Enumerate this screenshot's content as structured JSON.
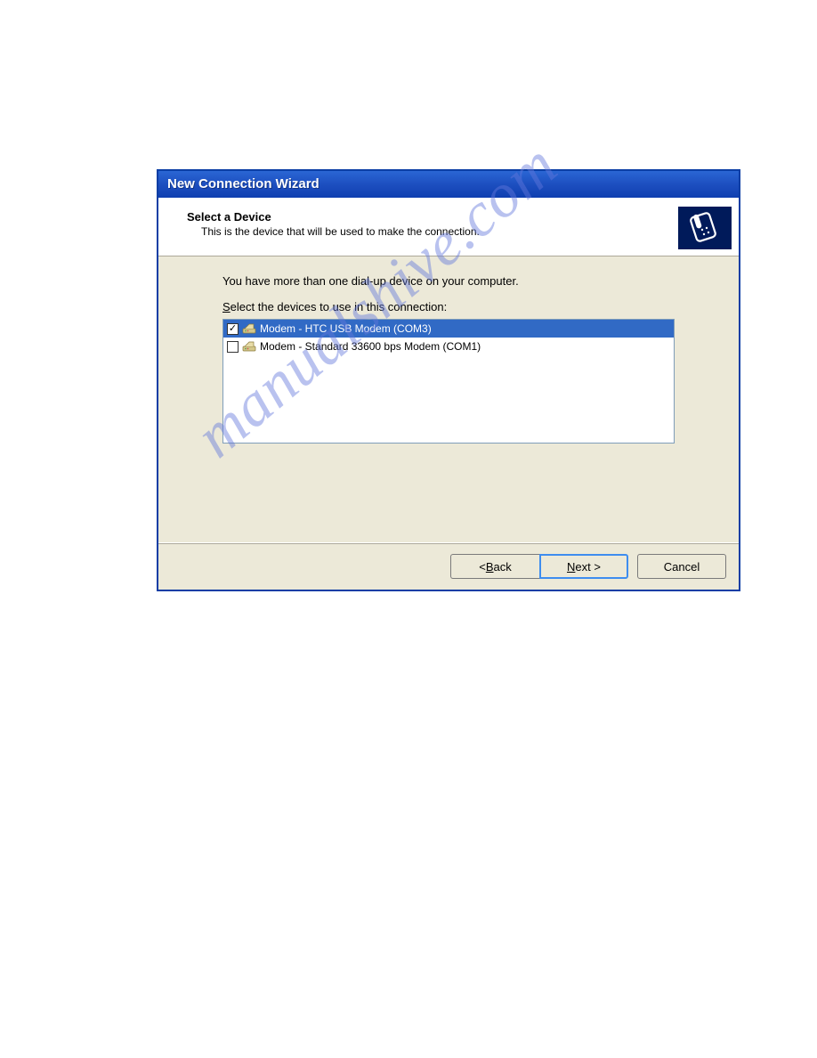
{
  "dialog": {
    "title": "New Connection Wizard",
    "header": {
      "title": "Select a Device",
      "subtitle": "This is the device that will be used to make the connection."
    },
    "content": {
      "instruction1": "You have more than one dial-up device on your computer.",
      "instruction2_prefix": "S",
      "instruction2_rest": "elect the devices to use in this connection:",
      "devices": [
        {
          "checked": true,
          "selected": true,
          "label": "Modem - HTC USB Modem (COM3)"
        },
        {
          "checked": false,
          "selected": false,
          "label": "Modem - Standard 33600 bps Modem (COM1)"
        }
      ]
    },
    "footer": {
      "back_prefix": "< ",
      "back_u": "B",
      "back_rest": "ack",
      "next_u": "N",
      "next_rest": "ext >",
      "cancel": "Cancel"
    }
  },
  "watermark": "manualshive.com"
}
